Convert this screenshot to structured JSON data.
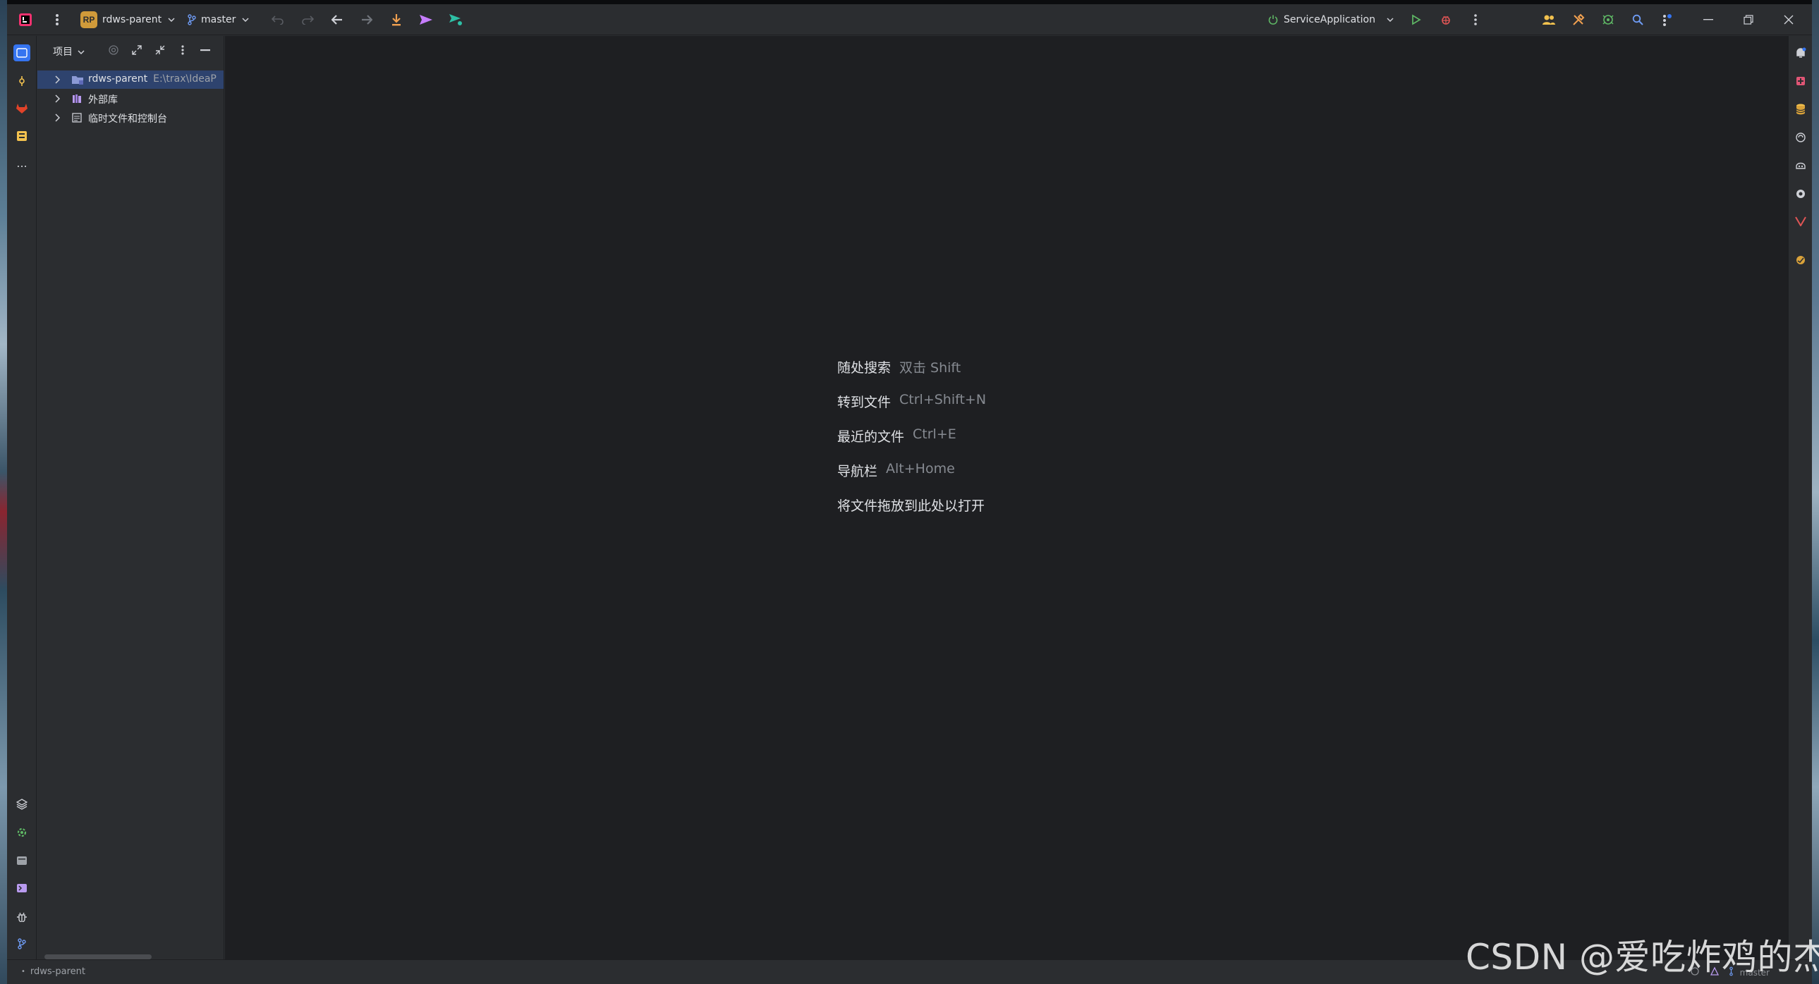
{
  "titlebar": {
    "project_badge": "RP",
    "project_name": "rdws-parent",
    "branch": "master",
    "run_config": "ServiceApplication",
    "icons": [
      "intellij-logo-icon",
      "main-menu-icon",
      "undo-icon",
      "redo-icon",
      "back-icon",
      "forward-icon",
      "update-project-icon",
      "push-icon",
      "commit-push-icon",
      "power-icon",
      "run-icon",
      "debug-icon",
      "more-icon",
      "code-with-me-icon",
      "settings-tools-icon",
      "plugin-icon",
      "search-icon",
      "vcs-operations-icon",
      "minimize-icon",
      "restore-icon",
      "close-icon"
    ],
    "colors": {
      "badge": "#d09a3a",
      "accent": "#3574f0",
      "run": "#5fb865",
      "debug": "#e05555",
      "push": "#c77dff",
      "commit_push": "#2ebfa5"
    }
  },
  "left_strip": {
    "top_icons": [
      "project-icon",
      "commit-icon",
      "gitlab-icon",
      "structure-icon",
      "more-tools-icon"
    ],
    "bottom_icons": [
      "layers-icon",
      "services-icon",
      "terminal-icon",
      "console-icon",
      "problems-icon",
      "git-icon"
    ],
    "more_label": "..."
  },
  "project_panel": {
    "title": "项目",
    "header_icons": [
      "locate-icon",
      "expand-all-icon",
      "collapse-all-icon",
      "options-icon",
      "hide-icon"
    ],
    "tree": [
      {
        "label": "rdws-parent",
        "path": "E:\\trax\\IdeaP",
        "icon": "module-folder-icon",
        "selected": true
      },
      {
        "label": "外部库",
        "path": "",
        "icon": "library-icon",
        "selected": false
      },
      {
        "label": "临时文件和控制台",
        "path": "",
        "icon": "scratches-icon",
        "selected": false
      }
    ]
  },
  "editor": {
    "hints": [
      {
        "action": "随处搜索",
        "keys": "双击 Shift"
      },
      {
        "action": "转到文件",
        "keys": "Ctrl+Shift+N"
      },
      {
        "action": "最近的文件",
        "keys": "Ctrl+E"
      },
      {
        "action": "导航栏",
        "keys": "Alt+Home"
      },
      {
        "action": "将文件拖放到此处以打开",
        "keys": ""
      }
    ]
  },
  "right_strip": {
    "icons": [
      "notifications-icon",
      "plugin-red-icon",
      "database-icon",
      "ai-assistant-icon",
      "copilot-icon",
      "settings-sync-icon",
      "vue-icon",
      "sonar-icon"
    ]
  },
  "statusbar": {
    "breadcrumb": "rdws-parent",
    "branch": "master"
  },
  "watermark": "CSDN @爱吃炸鸡的杰"
}
